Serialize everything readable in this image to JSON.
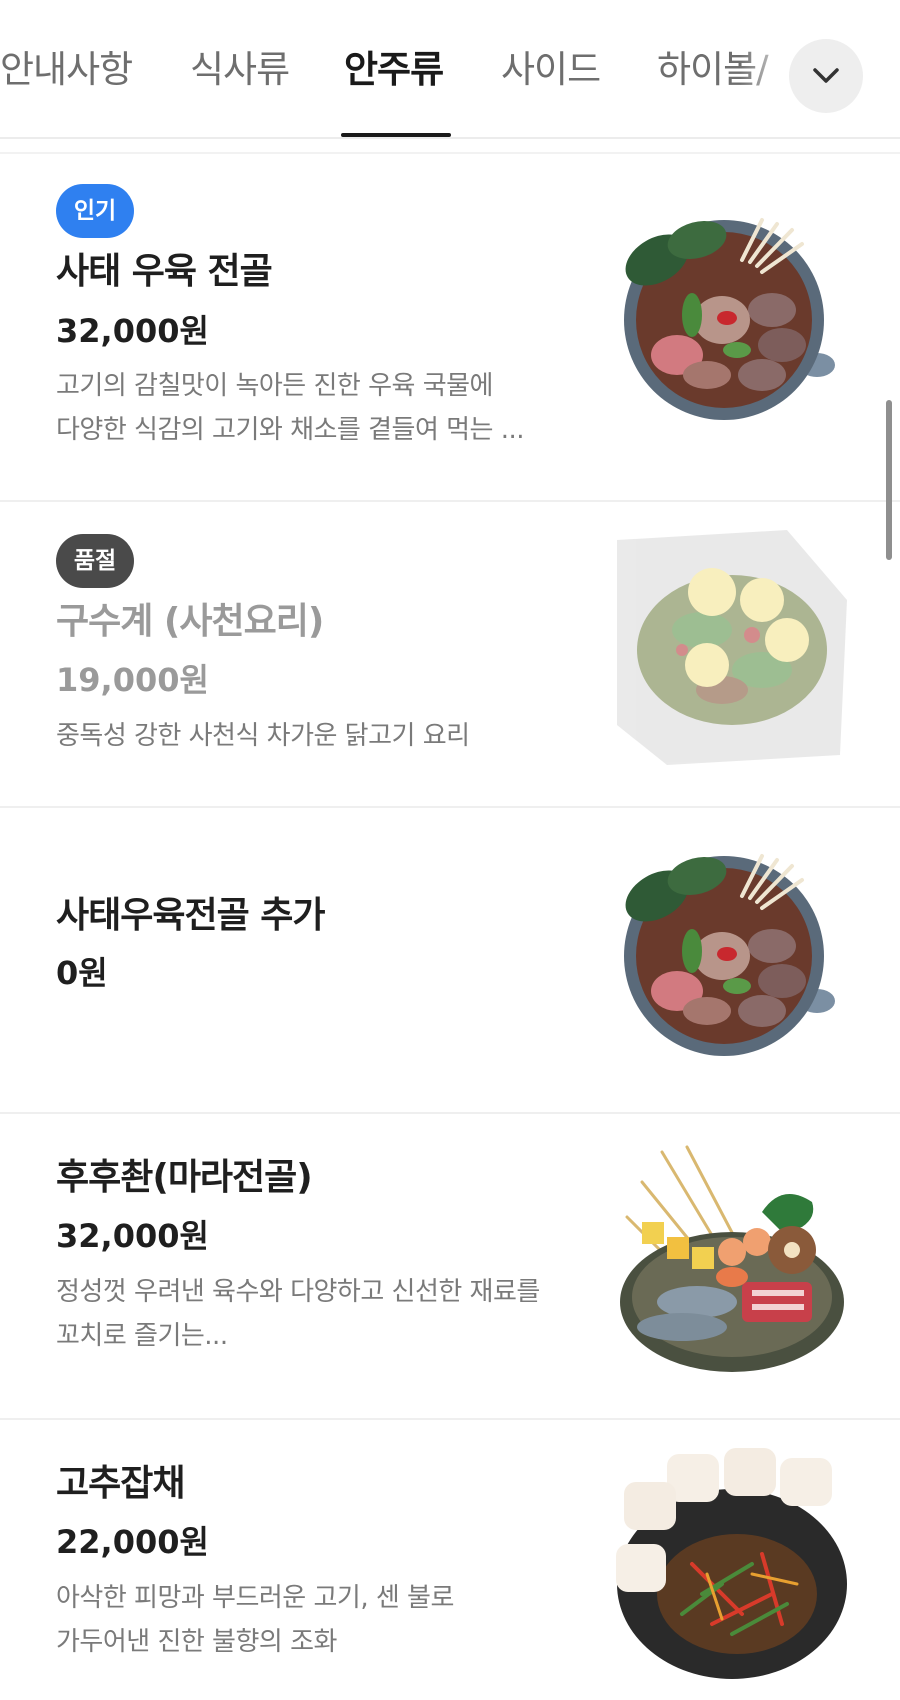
{
  "tabs": [
    {
      "label": "안내사항",
      "active": false
    },
    {
      "label": "식사류",
      "active": false
    },
    {
      "label": "안주류",
      "active": true
    },
    {
      "label": "사이드",
      "active": false
    },
    {
      "label": "하이볼/",
      "active": false
    }
  ],
  "expand_icon": "chevron-down-icon",
  "menu_items": [
    {
      "badge": "인기",
      "name": "사태 우육 전골",
      "price": "32,000원",
      "desc_lines": [
        "고기의 감칠맛이 녹아든 진한 우육 국물에",
        "다양한 식감의 고기와 채소를 곁들여 먹는 ..."
      ],
      "sold_out": false
    },
    {
      "badge": "품절",
      "name": "구수계 (사천요리)",
      "price": "19,000원",
      "desc_lines": [
        "중독성 강한 사천식 차가운 닭고기 요리"
      ],
      "sold_out": true
    },
    {
      "badge": "",
      "name": "사태우육전골 추가",
      "price": "0원",
      "desc_lines": [],
      "sold_out": false
    },
    {
      "badge": "",
      "name": "후후촨(마라전골)",
      "price": "32,000원",
      "desc_lines": [
        "정성껏 우려낸 육수와 다양하고 신선한 재료를",
        "꼬치로 즐기는..."
      ],
      "sold_out": false
    },
    {
      "badge": "",
      "name": "고추잡채",
      "price": "22,000원",
      "desc_lines": [
        "아삭한 피망과 부드러운 고기, 센 불로",
        "가두어낸 진한 불향의 조화"
      ],
      "sold_out": false
    }
  ],
  "colors": {
    "popular_badge": "#2f80f0",
    "soldout_badge": "#4a4a4a",
    "text_primary": "#1f1f1f",
    "text_secondary": "#7a7a7a"
  }
}
